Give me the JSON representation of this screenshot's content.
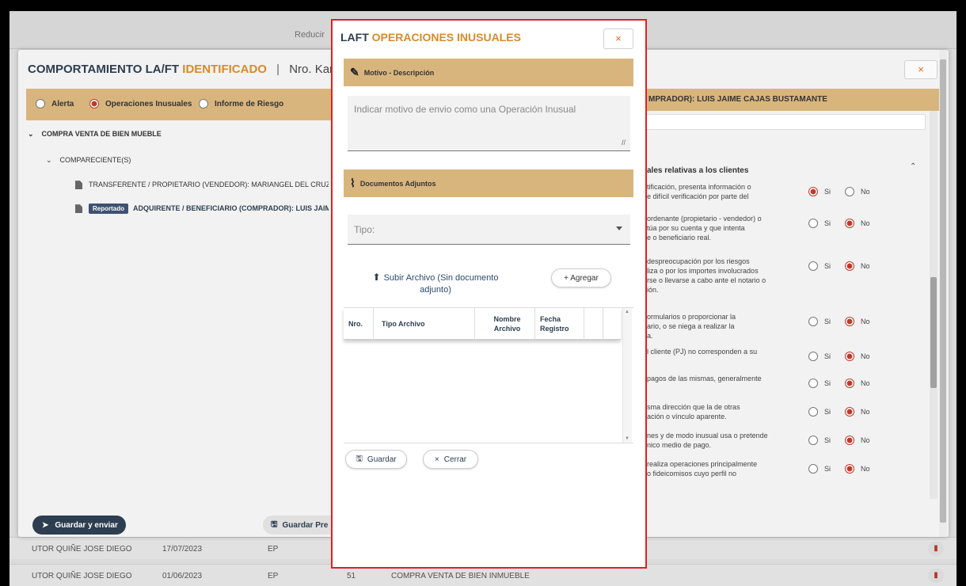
{
  "background": {
    "reducir_label": "Reducir",
    "rows": [
      {
        "name": "UTOR QUIÑE JOSE DIEGO",
        "date": "17/07/2023",
        "type": "EP",
        "num": "",
        "desc": ""
      },
      {
        "name": "UTOR QUIÑE JOSE DIEGO",
        "date": "01/06/2023",
        "type": "EP",
        "num": "51",
        "desc": "COMPRA VENTA DE BIEN INMUEBLE"
      }
    ]
  },
  "outer": {
    "title_part1": "COMPORTAMIENTO LA/FT",
    "title_accent": "IDENTIFICADO",
    "separator": "|",
    "kardex": "Nro. Kardex : AC",
    "close_label": "×",
    "radios": [
      {
        "label": "Alerta",
        "selected": false
      },
      {
        "label": "Operaciones Inusuales",
        "selected": true
      },
      {
        "label": "Informe de Riesgo",
        "selected": false
      }
    ],
    "tree": {
      "root": "COMPRA VENTA DE BIEN MUEBLE",
      "group": "COMPARECIENTE(S)",
      "item1": "TRANSFERENTE / PROPIETARIO (VENDEDOR): MARIANGEL DEL CRUZADO CHUM",
      "item2_tag": "Reportado",
      "item2": "ADQUIRENTE / BENEFICIARIO (COMPRADOR): LUIS JAIME CAJAS I"
    },
    "right_header": "MPRADOR): LUIS JAIME CAJAS BUSTAMANTE",
    "section_title": "ales relativas a los clientes",
    "questions": [
      {
        "text": "tificación, presenta información o\ne difícil verificación por parte del",
        "answer": "si"
      },
      {
        "text": "ordenante (propietario - vendedor) o\ntúa por su cuenta y que intenta\ne o beneficiario real.",
        "answer": "no"
      },
      {
        "text": "despreocupación por los riesgos\nliza o por los importes involucrados\nrse o llevarse a cabo ante el notario o\nión.",
        "answer": "no"
      },
      {
        "text": "ormularios o proporcionar la\nario, o se niega a realizar la\na.",
        "answer": "no"
      },
      {
        "text": "l cliente (PJ) no corresponden a su",
        "answer": "no"
      },
      {
        "text": "pagos de las mismas, generalmente",
        "answer": "no"
      },
      {
        "text": "sma dirección que la de otras\nación o vínculo aparente.",
        "answer": "no"
      },
      {
        "text": "nes y de modo inusual usa o pretende\nnico medio de pago.",
        "answer": "no"
      },
      {
        "text": "realiza operaciones principalmente\no fideicomisos cuyo perfil no",
        "answer": "no"
      }
    ],
    "si_label": "Si",
    "no_label": "No",
    "guardar_enviar": "Guardar y enviar",
    "guardar_pre": "Guardar Pre"
  },
  "modal": {
    "title_part1": "LAFT",
    "title_accent": "OPERACIONES INUSUALES",
    "close_label": "×",
    "motivo_header": "Motivo - Descripción",
    "motivo_placeholder": "Indicar motivo de envio como una Operación Inusual",
    "docs_header": "Documentos Adjuntos",
    "tipo_label": "Tipo:",
    "subir_label": "Subir Archivo (Sin documento adjunto)",
    "agregar_label": "+ Agregar",
    "table_headers": [
      "Nro.",
      "Tipo Archivo",
      "Nombre Archivo",
      "Fecha Registro"
    ],
    "guardar_label": "Guardar",
    "cerrar_label": "Cerrar"
  }
}
